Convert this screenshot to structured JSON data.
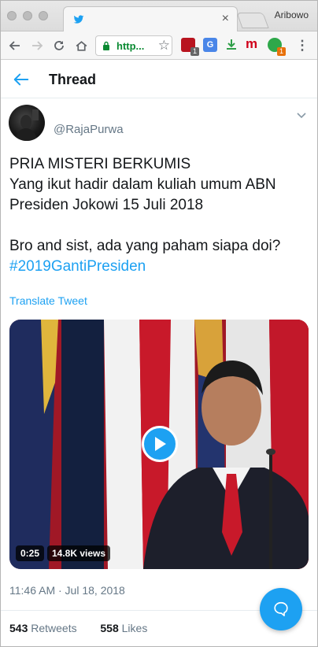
{
  "browser": {
    "profile_name": "Aribowo",
    "tab_close": "×",
    "address_text": "http...",
    "ext_badge_1": "1",
    "ext_badge_2": "1",
    "ext_m_label": "m"
  },
  "header": {
    "title": "Thread"
  },
  "tweet": {
    "handle": "@RajaPurwa",
    "text_lines": [
      "PRIA MISTERI BERKUMIS",
      "Yang ikut hadir dalam kuliah umum ABN",
      "Presiden Jokowi 15 Juli 2018",
      "Bro and sist, ada yang paham siapa doi?"
    ],
    "hashtag": "#2019GantiPresiden",
    "translate_label": "Translate Tweet",
    "video": {
      "duration": "0:25",
      "views": "14.8K views"
    },
    "timestamp": "11:46 AM · Jul 18, 2018",
    "retweets_count": "543",
    "retweets_label": "Retweets",
    "likes_count": "558",
    "likes_label": "Likes"
  },
  "colors": {
    "accent": "#1da1f2",
    "text_primary": "#14171a",
    "text_secondary": "#657786"
  },
  "icons": [
    "twitter-bird-icon",
    "back-arrow-icon",
    "forward-arrow-icon",
    "reload-icon",
    "home-icon",
    "lock-icon",
    "star-icon",
    "kebab-menu-icon",
    "chevron-down-icon",
    "play-icon",
    "reply-icon"
  ]
}
